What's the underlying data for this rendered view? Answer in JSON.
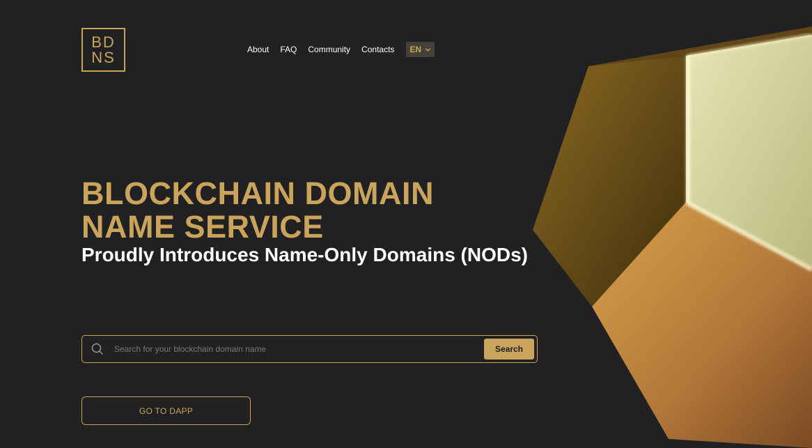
{
  "logo": {
    "line1": "BD",
    "line2": "NS"
  },
  "nav": {
    "items": [
      {
        "label": "About"
      },
      {
        "label": "FAQ"
      },
      {
        "label": "Community"
      },
      {
        "label": "Contacts"
      }
    ],
    "language": "EN"
  },
  "hero": {
    "title_line1": "BLOCKCHAIN DOMAIN",
    "title_line2": "NAME SERVICE",
    "subtitle": "Proudly Introduces Name-Only Domains (NODs)"
  },
  "search": {
    "placeholder": "Search for your blockchain domain name",
    "value": "",
    "button_label": "Search"
  },
  "dapp_button": {
    "label": "GO TO DAPP"
  },
  "colors": {
    "background": "#212124",
    "accent_gold": "#c9a45a",
    "text_white": "#ffffff"
  },
  "icons": {
    "search": "search-icon",
    "language_chevron": "chevron-down-icon",
    "hero_art": "gold-hexagon-decoration"
  }
}
